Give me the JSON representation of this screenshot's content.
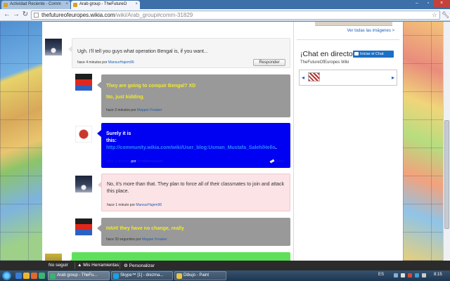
{
  "browser": {
    "tabs": [
      {
        "label": "Actividad Reciente - Comm",
        "active": false
      },
      {
        "label": "Arab group - TheFutureO",
        "active": true
      }
    ],
    "url_domain": "thefutureofeuropes.wikia.com",
    "url_path": "/wiki/Arab_group#comm-31829"
  },
  "rail": {
    "see_all_images": "Ver todas las imágenes >",
    "chat_title": "¡Chat en directo!",
    "chat_button": "Iniciar el Chat",
    "chat_wiki": "TheFutureOfEuropes Wiki"
  },
  "comments": [
    {
      "text": "Ugh. I'll tell you guys what operation Bengal is, if you want...",
      "meta_time": "hace 4 minutos por",
      "meta_user": "MansurHajem96",
      "reply": "Responder"
    },
    {
      "line1": "They are going to conquir Bengal? XD",
      "line2": "No, just kidding.",
      "meta_time": "hace 2 minutos por",
      "meta_user": "Mapper Freaker"
    },
    {
      "text_a": "Surely it is",
      "text_b": "this:",
      "link": "http://community.wikia.com/wiki/User_blog:Usman_Mustafa_Saleh/Hello",
      "text_after": ".",
      "meta_time": "hace 2 minutos",
      "meta_by": "por",
      "meta_user": "Scrottlasnazzaro",
      "edit": "Editar"
    },
    {
      "text": "No, it's more than that. They plan to force all of their classmates to join and attack this place.",
      "meta_time": "hace 1 minuto por",
      "meta_user": "MansurHajem96"
    },
    {
      "text": "HAH! they have no change, really",
      "meta_time": "hace 33 segundos por",
      "meta_user": "Mapper Freaker"
    }
  ],
  "wikia_toolbar": {
    "unfollow": "No seguir",
    "my_tools": "Mis Herramientas",
    "customize": "Personalizar"
  },
  "taskbar": {
    "tasks": [
      "Arab group - TheFu...",
      "Skype™ [1] - drezma...",
      "Dibujo - Paint"
    ],
    "lang": "ES",
    "clock": "8:15"
  }
}
